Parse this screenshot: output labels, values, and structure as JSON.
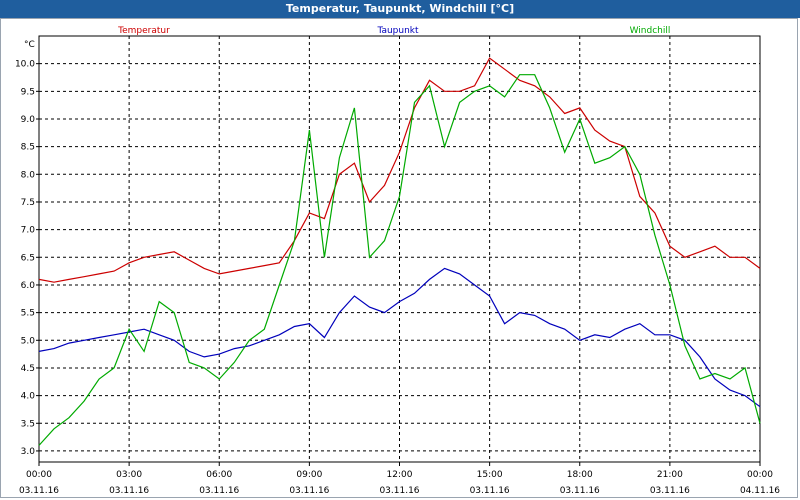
{
  "window": {
    "title": "Temperatur, Taupunkt, Windchill [°C]"
  },
  "chart_data": {
    "type": "line",
    "unit_label": "°C",
    "ylim": [
      2.8,
      10.5
    ],
    "y_ticks": [
      "3.0",
      "3.5",
      "4.0",
      "4.5",
      "5.0",
      "5.5",
      "6.0",
      "6.5",
      "7.0",
      "7.5",
      "8.0",
      "8.5",
      "9.0",
      "9.5",
      "10.0"
    ],
    "x_ticks": [
      {
        "time": "00:00",
        "date": "03.11.16"
      },
      {
        "time": "03:00",
        "date": "03.11.16"
      },
      {
        "time": "06:00",
        "date": "03.11.16"
      },
      {
        "time": "09:00",
        "date": "03.11.16"
      },
      {
        "time": "12:00",
        "date": "03.11.16"
      },
      {
        "time": "15:00",
        "date": "03.11.16"
      },
      {
        "time": "18:00",
        "date": "03.11.16"
      },
      {
        "time": "21:00",
        "date": "03.11.16"
      },
      {
        "time": "00:00",
        "date": "04.11.16"
      }
    ],
    "grid": true,
    "legend": "top",
    "x_hours": [
      0,
      0.5,
      1,
      1.5,
      2,
      2.5,
      3,
      3.5,
      4,
      4.5,
      5,
      5.5,
      6,
      6.5,
      7,
      7.5,
      8,
      8.5,
      9,
      9.5,
      10,
      10.5,
      11,
      11.5,
      12,
      12.5,
      13,
      13.5,
      14,
      14.5,
      15,
      15.5,
      16,
      16.5,
      17,
      17.5,
      18,
      18.5,
      19,
      19.5,
      20,
      20.5,
      21,
      21.5,
      22,
      22.5,
      23,
      23.5,
      24
    ],
    "series": [
      {
        "name": "Temperatur",
        "color": "#cc0000",
        "values": [
          6.1,
          6.05,
          6.1,
          6.15,
          6.2,
          6.25,
          6.4,
          6.5,
          6.55,
          6.6,
          6.45,
          6.3,
          6.2,
          6.25,
          6.3,
          6.35,
          6.4,
          6.8,
          7.3,
          7.2,
          8.0,
          8.2,
          7.5,
          7.8,
          8.4,
          9.2,
          9.7,
          9.5,
          9.5,
          9.6,
          10.1,
          9.9,
          9.7,
          9.6,
          9.4,
          9.1,
          9.2,
          8.8,
          8.6,
          8.5,
          7.6,
          7.3,
          6.7,
          6.5,
          6.6,
          6.7,
          6.5,
          6.5,
          6.3
        ]
      },
      {
        "name": "Taupunkt",
        "color": "#0000bb",
        "values": [
          4.8,
          4.85,
          4.95,
          5.0,
          5.05,
          5.1,
          5.15,
          5.2,
          5.1,
          5.0,
          4.8,
          4.7,
          4.75,
          4.85,
          4.9,
          5.0,
          5.1,
          5.25,
          5.3,
          5.05,
          5.5,
          5.8,
          5.6,
          5.5,
          5.7,
          5.85,
          6.1,
          6.3,
          6.2,
          6.0,
          5.8,
          5.3,
          5.5,
          5.45,
          5.3,
          5.2,
          5.0,
          5.1,
          5.05,
          5.2,
          5.3,
          5.1,
          5.1,
          5.0,
          4.7,
          4.3,
          4.1,
          4.0,
          3.8
        ]
      },
      {
        "name": "Windchill",
        "color": "#00aa00",
        "values": [
          3.1,
          3.4,
          3.6,
          3.9,
          4.3,
          4.5,
          5.2,
          4.8,
          5.7,
          5.5,
          4.6,
          4.5,
          4.3,
          4.6,
          5.0,
          5.2,
          6.0,
          6.8,
          8.8,
          6.5,
          8.3,
          9.2,
          6.5,
          6.8,
          7.6,
          9.3,
          9.6,
          8.5,
          9.3,
          9.5,
          9.6,
          9.4,
          9.8,
          9.8,
          9.2,
          8.4,
          9.0,
          8.2,
          8.3,
          8.5,
          8.0,
          6.9,
          6.0,
          4.9,
          4.3,
          4.4,
          4.3,
          4.5,
          3.5
        ]
      }
    ]
  }
}
